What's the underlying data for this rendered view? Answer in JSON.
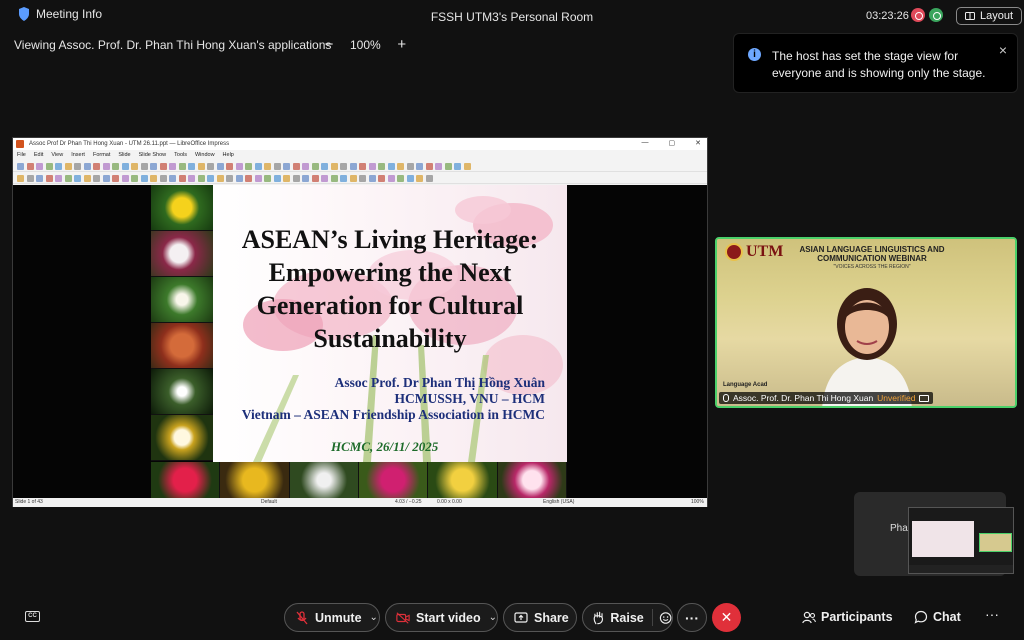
{
  "topbar": {
    "meeting_info": "Meeting Info",
    "room_title": "FSSH UTM3's Personal Room",
    "timer": "03:23:26",
    "layout_label": "Layout"
  },
  "share_header": {
    "viewing_text": "Viewing Assoc. Prof. Dr. Phan Thi Hong Xuan's applications",
    "zoom": "100%",
    "zoom_out": "−",
    "zoom_in": "+"
  },
  "toast": {
    "message": "The host has set the stage view for everyone and is showing only the stage.",
    "close": "×"
  },
  "app_window": {
    "title": "Assoc Prof Dr Phan Thi Hong Xuan - UTM 26.11.ppt — LibreOffice Impress",
    "controls": [
      "—",
      "▢",
      "✕"
    ],
    "menu": [
      "File",
      "Edit",
      "View",
      "Insert",
      "Format",
      "Slide",
      "Slide Show",
      "Tools",
      "Window",
      "Help"
    ],
    "status": {
      "slide_count": "Slide 1 of 43",
      "layout": "Default",
      "position": "4.03 / −0.25",
      "size": "0.00 x 0.00",
      "language": "English (USA)",
      "zoom": "100%"
    }
  },
  "slide": {
    "title_lines": [
      "ASEAN’s Living Heritage:",
      "Empowering the Next",
      "Generation for Cultural",
      "Sustainability"
    ],
    "author": "Assoc Prof. Dr Phan Thị Hồng Xuân",
    "affiliation": "HCMUSSH, VNU – HCM",
    "association": "Vietnam – ASEAN Friendship Association in HCMC",
    "date": "HCMC, 26/11/ 2025"
  },
  "video": {
    "utm": "UTM",
    "webinar_title": "ASIAN LANGUAGE LINGUISTICS AND COMMUNICATION WEBINAR",
    "webinar_subtitle": "\"VOICES ACROSS THE REGION\"",
    "organizer": "Language Acad",
    "name": "Assoc. Prof. Dr. Phan Thi Hong Xuan",
    "verification": "Unverified"
  },
  "selfview": {
    "name": "Pha"
  },
  "controls": {
    "cc": "CC",
    "unmute": "Unmute",
    "start_video": "Start video",
    "share": "Share",
    "raise": "Raise",
    "more": "···",
    "end": "✕",
    "participants": "Participants",
    "chat": "Chat",
    "overflow": "···"
  },
  "colors": {
    "background": "#111111",
    "end_button": "#e0303a",
    "active_speaker_border": "#4bd06a",
    "info_accent": "#6ea8ff",
    "slide_title": "#111111",
    "slide_author": "#1d2f7a",
    "slide_date": "#1d6b2a"
  }
}
